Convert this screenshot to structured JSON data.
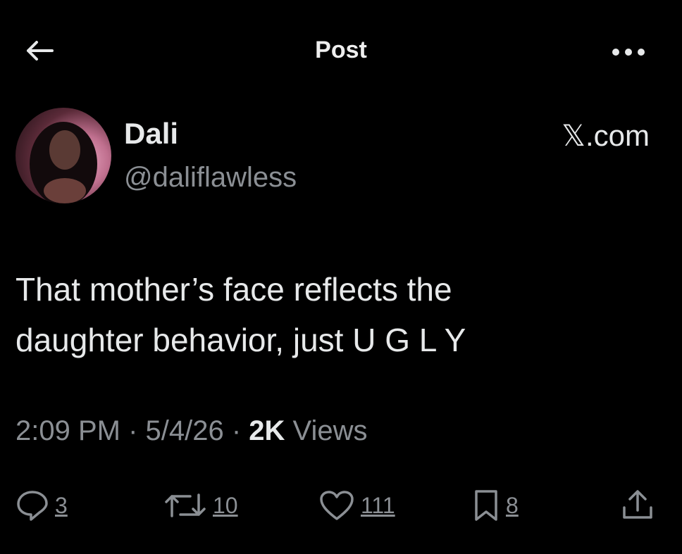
{
  "header": {
    "title": "Post"
  },
  "author": {
    "display_name": "Dali",
    "handle": "@daliflawless",
    "source": "𝕏.com"
  },
  "post": {
    "text_line1": "That mother’s face reflects the",
    "text_line2": "daughter behavior, just U G L Y"
  },
  "meta": {
    "time": "2:09 PM",
    "separator1": " · ",
    "date": "5/4/26",
    "separator2": " · ",
    "views_count": "2K",
    "views_label": " Views"
  },
  "actions": {
    "replies": "3",
    "reposts": "10",
    "likes": "111",
    "bookmarks": "8"
  },
  "icons": {
    "back": "arrow-left-icon",
    "more": "more-dots-icon",
    "reply": "reply-icon",
    "repost": "repost-icon",
    "like": "heart-icon",
    "bookmark": "bookmark-icon",
    "share": "share-icon"
  },
  "colors": {
    "background": "#000000",
    "text_primary": "#e7e9ea",
    "text_secondary": "#8b8f94"
  }
}
